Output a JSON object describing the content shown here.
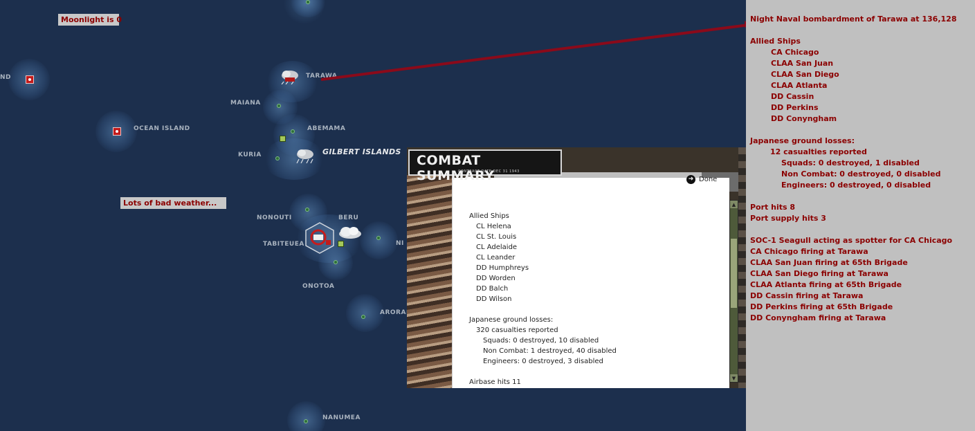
{
  "map": {
    "notes": {
      "moonlight": "Moonlight is 0",
      "weather": "Lots of bad weather..."
    },
    "labels": {
      "nd": "ND",
      "tarawa": "TARAWA",
      "maiana": "MAIANA",
      "ocean_island": "OCEAN ISLAND",
      "abemama": "ABEMAMA",
      "kuria": "KURIA",
      "gilbert_islands": "GILBERT ISLANDS",
      "nonouti": "NONOUTI",
      "beru": "BERU",
      "tabiteuea": "TABITEUEA",
      "ni": "NI",
      "onotoa": "ONOTOA",
      "arorae": "ARORAE",
      "nanumea": "NANUMEA"
    },
    "colors": {
      "ocean": "#1c2f4d",
      "note_text": "#8b0000",
      "note_bg": "#c8c8c8",
      "pointer_line": "#8b0a1a"
    }
  },
  "combat_summary": {
    "title": "COMBAT SUMMARY",
    "subtitle": "CONTRACT DATE DEC 31 1943",
    "done_label": "Done",
    "lines": [
      {
        "text": "Allied Ships",
        "indent": 0
      },
      {
        "text": "CL Helena",
        "indent": 1
      },
      {
        "text": "CL St. Louis",
        "indent": 1
      },
      {
        "text": "CL Adelaide",
        "indent": 1
      },
      {
        "text": "CL Leander",
        "indent": 1
      },
      {
        "text": "DD Humphreys",
        "indent": 1
      },
      {
        "text": "DD Worden",
        "indent": 1
      },
      {
        "text": "DD Balch",
        "indent": 1
      },
      {
        "text": "DD Wilson",
        "indent": 1
      },
      {
        "text": "",
        "indent": 0
      },
      {
        "text": "Japanese ground losses:",
        "indent": 0
      },
      {
        "text": "320 casualties reported",
        "indent": 1
      },
      {
        "text": "Squads: 0 destroyed, 10 disabled",
        "indent": 2
      },
      {
        "text": "Non Combat: 1 destroyed, 40 disabled",
        "indent": 2
      },
      {
        "text": "Engineers: 0 destroyed, 3 disabled",
        "indent": 2
      },
      {
        "text": "",
        "indent": 0
      },
      {
        "text": "Airbase hits 11",
        "indent": 0
      }
    ]
  },
  "message_panel": {
    "lines": [
      {
        "text": "Night Naval bombardment of Tarawa at 136,128",
        "indent": 0
      },
      {
        "text": "",
        "indent": 0
      },
      {
        "text": "Allied Ships",
        "indent": 0
      },
      {
        "text": "CA Chicago",
        "indent": 1
      },
      {
        "text": "CLAA San Juan",
        "indent": 1
      },
      {
        "text": "CLAA San Diego",
        "indent": 1
      },
      {
        "text": "CLAA Atlanta",
        "indent": 1
      },
      {
        "text": "DD Cassin",
        "indent": 1
      },
      {
        "text": "DD Perkins",
        "indent": 1
      },
      {
        "text": "DD Conyngham",
        "indent": 1
      },
      {
        "text": "",
        "indent": 0
      },
      {
        "text": "Japanese ground losses:",
        "indent": 0
      },
      {
        "text": "12 casualties reported",
        "indent": 1
      },
      {
        "text": "Squads: 0 destroyed, 1 disabled",
        "indent": 2
      },
      {
        "text": "Non Combat: 0 destroyed, 0 disabled",
        "indent": 2
      },
      {
        "text": "Engineers: 0 destroyed, 0 disabled",
        "indent": 2
      },
      {
        "text": "",
        "indent": 0
      },
      {
        "text": "Port hits 8",
        "indent": 0
      },
      {
        "text": "Port supply hits 3",
        "indent": 0
      },
      {
        "text": "",
        "indent": 0
      },
      {
        "text": "SOC-1 Seagull acting as spotter for CA Chicago",
        "indent": 0
      },
      {
        "text": "CA Chicago firing at Tarawa",
        "indent": 0
      },
      {
        "text": "CLAA San Juan firing at 65th Brigade",
        "indent": 0
      },
      {
        "text": "CLAA San Diego firing at Tarawa",
        "indent": 0
      },
      {
        "text": "CLAA Atlanta firing at 65th Brigade",
        "indent": 0
      },
      {
        "text": "DD Cassin firing at Tarawa",
        "indent": 0
      },
      {
        "text": "DD Perkins firing at 65th Brigade",
        "indent": 0
      },
      {
        "text": "DD Conyngham firing at Tarawa",
        "indent": 0
      }
    ]
  }
}
